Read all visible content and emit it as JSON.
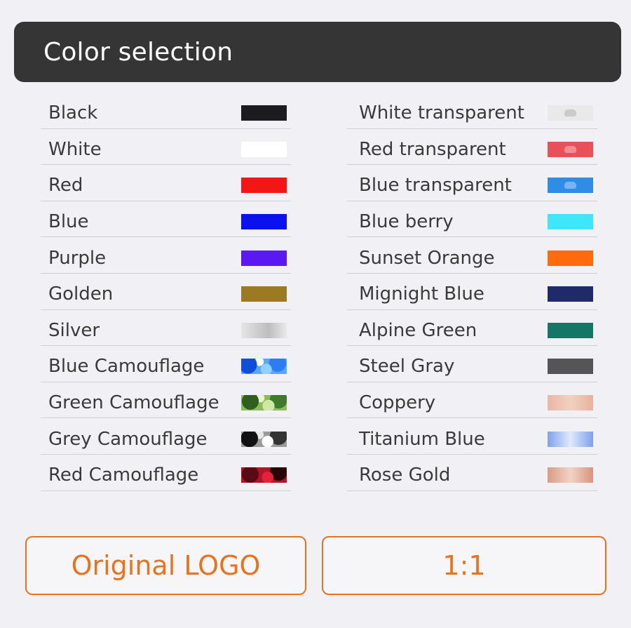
{
  "header": {
    "title": "Color selection"
  },
  "colors_left": [
    {
      "label": "Black",
      "swatch": "sw-black",
      "hex": "#1c1c1e"
    },
    {
      "label": "White",
      "swatch": "sw-white",
      "hex": "#ffffff"
    },
    {
      "label": "Red",
      "swatch": "sw-red",
      "hex": "#f21616"
    },
    {
      "label": "Blue",
      "swatch": "sw-blue",
      "hex": "#0a12f0"
    },
    {
      "label": "Purple",
      "swatch": "sw-purple",
      "hex": "#5a18f2"
    },
    {
      "label": "Golden",
      "swatch": "sw-golden",
      "hex": "#9b7a22"
    },
    {
      "label": "Silver",
      "swatch": "sw-silver",
      "hex": "#d0d0d0"
    },
    {
      "label": "Blue Camouflage",
      "swatch": "sw-bluecamo",
      "hex": "#5aa8f5"
    },
    {
      "label": "Green Camouflage",
      "swatch": "sw-greencamo",
      "hex": "#8cbc5a"
    },
    {
      "label": "Grey Camouflage",
      "swatch": "sw-greycamo",
      "hex": "#9a9a9a"
    },
    {
      "label": "Red Camouflage",
      "swatch": "sw-redcamo",
      "hex": "#b11428"
    }
  ],
  "colors_right": [
    {
      "label": "White transparent",
      "swatch": "sw-whitetr",
      "hex": "#e9e9ea"
    },
    {
      "label": "Red transparent",
      "swatch": "sw-redtr",
      "hex": "#e8505a"
    },
    {
      "label": "Blue transparent",
      "swatch": "sw-bluetr",
      "hex": "#2f8de8"
    },
    {
      "label": "Blue berry",
      "swatch": "sw-berry",
      "hex": "#3fe6f7"
    },
    {
      "label": "Sunset Orange",
      "swatch": "sw-orange",
      "hex": "#ff6a0d"
    },
    {
      "label": "Mignight Blue",
      "swatch": "sw-midnight",
      "hex": "#1e2a6a"
    },
    {
      "label": "Alpine Green",
      "swatch": "sw-alpine",
      "hex": "#147766"
    },
    {
      "label": "Steel Gray",
      "swatch": "sw-steel",
      "hex": "#555557"
    },
    {
      "label": "Coppery",
      "swatch": "sw-coppery",
      "hex": "#eec3b2"
    },
    {
      "label": "Titanium Blue",
      "swatch": "sw-titanium",
      "hex": "#a9c2f2"
    },
    {
      "label": "Rose Gold",
      "swatch": "sw-rosegold",
      "hex": "#e6b5a4"
    }
  ],
  "buttons": {
    "logo_label": "Original LOGO",
    "ratio_label": "1:1"
  },
  "theme": {
    "accent": "#e8731e",
    "header_bg": "#353535",
    "page_bg": "#f1f1f5"
  }
}
